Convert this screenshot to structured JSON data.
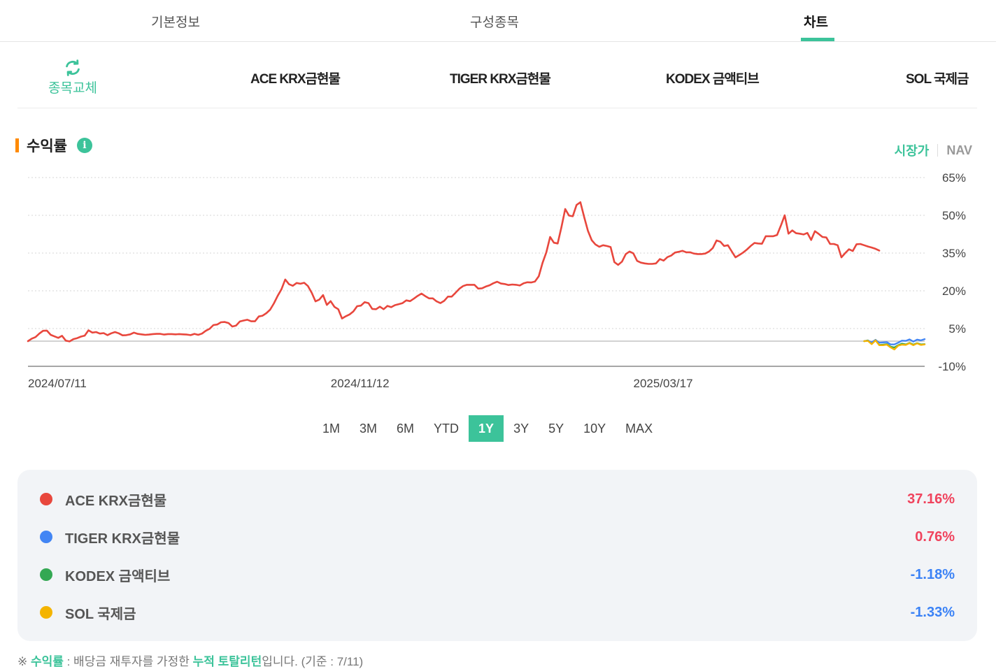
{
  "tabs": [
    {
      "label": "기본정보",
      "active": false
    },
    {
      "label": "구성종목",
      "active": false
    },
    {
      "label": "차트",
      "active": true
    }
  ],
  "compare": {
    "swap_label": "종목교체",
    "etfs": [
      "ACE KRX금현물",
      "TIGER KRX금현물",
      "KODEX 금액티브",
      "SOL 국제금"
    ]
  },
  "section": {
    "title": "수익률",
    "info_icon": "i"
  },
  "price_toggle": {
    "market": "시장가",
    "nav": "NAV",
    "selected": "시장가"
  },
  "ranges": [
    "1M",
    "3M",
    "6M",
    "YTD",
    "1Y",
    "3Y",
    "5Y",
    "10Y",
    "MAX"
  ],
  "selected_range": "1Y",
  "legend": [
    {
      "name": "ACE KRX금현물",
      "value": "37.16%",
      "color": "#e8473d",
      "value_color": "#f0435d"
    },
    {
      "name": "TIGER KRX금현물",
      "value": "0.76%",
      "color": "#4285f4",
      "value_color": "#f0435d"
    },
    {
      "name": "KODEX 금액티브",
      "value": "-1.18%",
      "color": "#34a853",
      "value_color": "#3b82f6"
    },
    {
      "name": "SOL 국제금",
      "value": "-1.33%",
      "color": "#f4b400",
      "value_color": "#3b82f6"
    }
  ],
  "footnote": {
    "prefix": "※ ",
    "term1": "수익률",
    "mid": " : 배당금 재투자를 가정한 ",
    "term2": "누적 토탈리턴",
    "suffix": "입니다. (기준 : 7/11)"
  },
  "chart_data": {
    "type": "line",
    "ylim": [
      -10,
      65
    ],
    "y_ticks": [
      "65%",
      "50%",
      "35%",
      "20%",
      "5%",
      "-10%"
    ],
    "y_tick_values": [
      65,
      50,
      35,
      20,
      5,
      -10
    ],
    "baseline": 0,
    "x_labels": [
      "2024/07/11",
      "2024/11/12",
      "2025/03/17"
    ],
    "x_label_index": [
      0,
      80,
      160
    ],
    "n_points": 238,
    "series": [
      {
        "name": "ACE KRX금현물",
        "color": "#e8473d",
        "start_index": 0,
        "values": [
          0.0,
          1.0,
          1.6,
          3.0,
          4.1,
          4.2,
          2.5,
          1.9,
          1.3,
          2.1,
          0.2,
          -0.1,
          0.8,
          1.2,
          1.8,
          2.2,
          4.3,
          3.4,
          3.6,
          3.0,
          3.2,
          2.4,
          3.1,
          3.6,
          3.1,
          2.3,
          2.4,
          2.7,
          3.4,
          2.9,
          2.7,
          2.5,
          2.6,
          2.8,
          2.9,
          2.9,
          2.6,
          2.8,
          2.8,
          2.7,
          2.8,
          2.7,
          2.6,
          2.4,
          2.9,
          2.5,
          3.0,
          4.1,
          4.9,
          6.4,
          6.6,
          7.5,
          7.6,
          7.2,
          5.8,
          6.2,
          7.8,
          8.2,
          8.5,
          7.9,
          7.9,
          9.8,
          10.1,
          11.1,
          12.5,
          15.0,
          18.0,
          20.6,
          24.5,
          22.6,
          22.0,
          23.1,
          22.8,
          23.2,
          21.9,
          19.2,
          15.8,
          16.5,
          18.3,
          14.4,
          15.9,
          13.6,
          12.7,
          9.0,
          9.9,
          10.6,
          11.8,
          13.9,
          14.1,
          15.5,
          15.1,
          12.8,
          12.7,
          13.7,
          12.7,
          14.0,
          13.5,
          14.3,
          14.7,
          15.1,
          16.2,
          15.9,
          16.9,
          18.0,
          18.9,
          17.9,
          17.0,
          17.0,
          15.8,
          15.1,
          16.0,
          17.7,
          17.7,
          19.2,
          20.8,
          21.9,
          22.4,
          22.4,
          22.4,
          20.9,
          21.0,
          21.7,
          22.2,
          23.0,
          23.6,
          22.9,
          22.7,
          22.3,
          22.5,
          22.4,
          22.1,
          23.0,
          23.4,
          23.3,
          23.7,
          25.8,
          31.1,
          35.3,
          41.4,
          39.1,
          38.8,
          45.3,
          52.5,
          49.9,
          49.6,
          54.1,
          55.2,
          49.3,
          43.8,
          40.1,
          38.4,
          37.5,
          38.1,
          37.8,
          37.4,
          31.4,
          30.3,
          31.6,
          34.6,
          35.6,
          34.9,
          31.9,
          31.2,
          30.9,
          30.7,
          30.7,
          30.9,
          32.6,
          32.0,
          33.4,
          34.0,
          35.2,
          35.5,
          35.9,
          35.3,
          35.3,
          34.8,
          34.6,
          34.6,
          34.8,
          35.6,
          37.0,
          40.0,
          39.5,
          37.8,
          38.1,
          35.7,
          33.3,
          34.2,
          35.2,
          36.4,
          37.8,
          39.0,
          38.8,
          38.7,
          41.7,
          41.7,
          41.7,
          42.2,
          45.9,
          50.0,
          42.7,
          44.0,
          42.9,
          42.7,
          42.4,
          43.0,
          40.2,
          43.7,
          42.6,
          41.4,
          41.2,
          38.6,
          38.6,
          38.1,
          33.3,
          35.0,
          36.5,
          35.8,
          38.5,
          38.6,
          38.1,
          37.6,
          37.2,
          36.7,
          36.0
        ]
      },
      {
        "name": "TIGER KRX금현물",
        "color": "#4285f4",
        "start_index": 221,
        "values": [
          0.0,
          0.2,
          -0.5,
          0.5,
          -0.6,
          -0.5,
          -0.4,
          -1.3,
          -1.3,
          -0.6,
          0.2,
          0.1,
          0.7,
          -0.2,
          0.6,
          0.3,
          0.8
        ]
      },
      {
        "name": "KODEX 금액티브",
        "color": "#34a853",
        "start_index": 221,
        "values": [
          0.0,
          0.3,
          -0.9,
          0.5,
          -1.5,
          -1.4,
          -1.2,
          -2.2,
          -2.5,
          -1.6,
          -1.0,
          -1.3,
          -0.7,
          -1.4,
          -0.8,
          -1.3,
          -1.2
        ]
      },
      {
        "name": "SOL 국제금",
        "color": "#f4b400",
        "start_index": 221,
        "values": [
          0.0,
          0.1,
          -1.2,
          0.3,
          -1.6,
          -1.6,
          -1.4,
          -2.5,
          -3.3,
          -1.8,
          -1.4,
          -1.5,
          -0.8,
          -1.6,
          -0.9,
          -1.5,
          -1.3
        ]
      }
    ],
    "grid": true
  }
}
